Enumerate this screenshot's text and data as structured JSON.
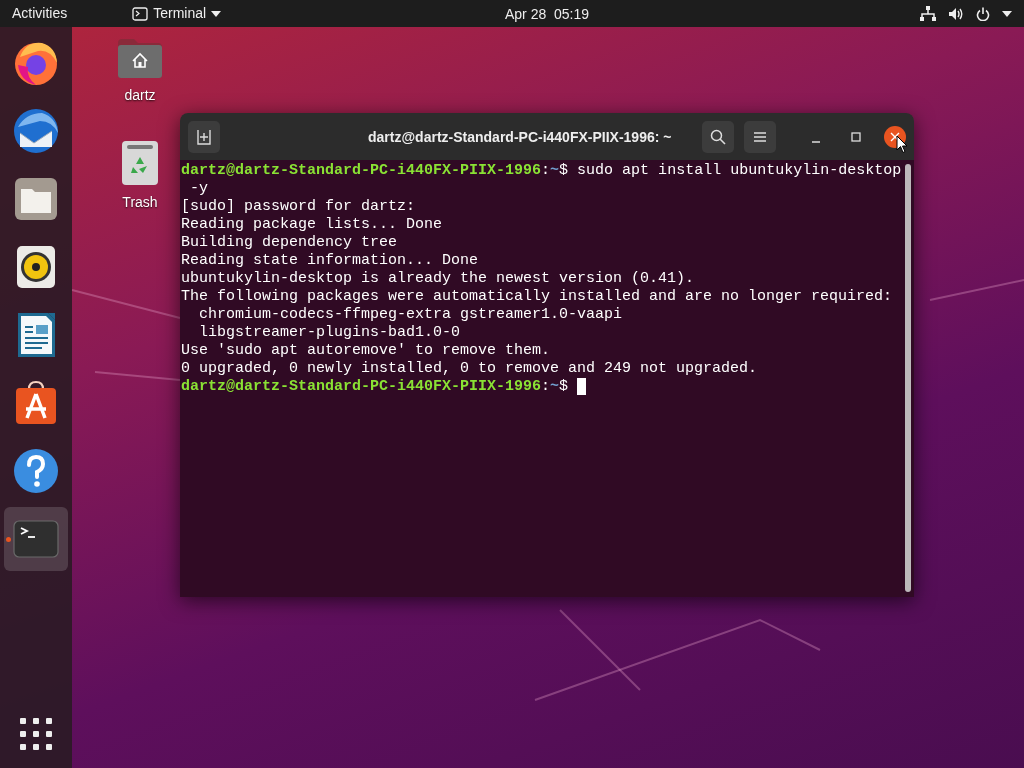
{
  "top_bar": {
    "activities": "Activities",
    "app_menu": "Terminal",
    "clock": "Apr 28  05:19"
  },
  "dock": {
    "items": [
      {
        "kind": "firefox",
        "running": false,
        "selected": false
      },
      {
        "kind": "thunderbird",
        "running": false,
        "selected": false
      },
      {
        "kind": "files",
        "running": false,
        "selected": false
      },
      {
        "kind": "rhythmbox",
        "running": false,
        "selected": false
      },
      {
        "kind": "writer",
        "running": false,
        "selected": false
      },
      {
        "kind": "software",
        "running": false,
        "selected": false
      },
      {
        "kind": "help",
        "running": false,
        "selected": false
      },
      {
        "kind": "terminal",
        "running": true,
        "selected": true
      }
    ]
  },
  "desktop_icons": [
    {
      "kind": "home",
      "label": "dartz"
    },
    {
      "kind": "trash",
      "label": "Trash"
    }
  ],
  "terminal_window": {
    "title": "dartz@dartz-Standard-PC-i440FX-PIIX-1996: ~",
    "close_hovered": true,
    "lines": [
      {
        "kind": "prompt",
        "user_host": "dartz@dartz-Standard-PC-i440FX-PIIX-1996",
        "separator": ":",
        "path": "~",
        "symbol": "$",
        "command": " sudo apt install ubuntukylin-desktop -y"
      },
      {
        "kind": "output",
        "text": "[sudo] password for dartz:"
      },
      {
        "kind": "output",
        "text": "Reading package lists... Done"
      },
      {
        "kind": "output",
        "text": "Building dependency tree"
      },
      {
        "kind": "output",
        "text": "Reading state information... Done"
      },
      {
        "kind": "output",
        "text": "ubuntukylin-desktop is already the newest version (0.41)."
      },
      {
        "kind": "output",
        "text": "The following packages were automatically installed and are no longer required:"
      },
      {
        "kind": "output",
        "text": "  chromium-codecs-ffmpeg-extra gstreamer1.0-vaapi"
      },
      {
        "kind": "output",
        "text": "  libgstreamer-plugins-bad1.0-0"
      },
      {
        "kind": "output",
        "text": "Use 'sudo apt autoremove' to remove them."
      },
      {
        "kind": "output",
        "text": "0 upgraded, 0 newly installed, 0 to remove and 249 not upgraded."
      },
      {
        "kind": "prompt",
        "user_host": "dartz@dartz-Standard-PC-i440FX-PIIX-1996",
        "separator": ":",
        "path": "~",
        "symbol": "$",
        "cursor": true
      }
    ]
  }
}
